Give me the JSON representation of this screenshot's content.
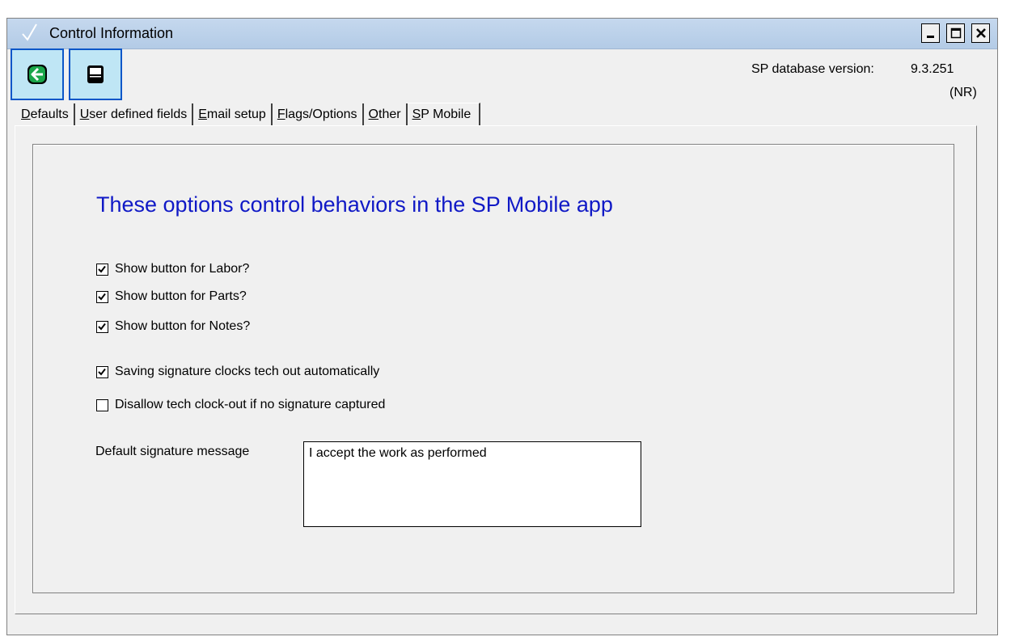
{
  "window": {
    "title": "Control Information",
    "controls": {
      "minimize_icon": "minimize-icon",
      "maximize_icon": "maximize-icon",
      "close_icon": "close-icon"
    }
  },
  "toolbar": {
    "back_icon": "back-arrow-icon",
    "save_icon": "floppy-disk-icon"
  },
  "version": {
    "label": "SP database version:",
    "value": "9.3.251",
    "suffix": "(NR)"
  },
  "tabs": [
    {
      "label": "Defaults",
      "hotkey": "D",
      "rest": "efaults",
      "active": false
    },
    {
      "label": "User defined fields",
      "hotkey": "U",
      "rest": "ser defined fields",
      "active": false
    },
    {
      "label": "Email setup",
      "hotkey": "E",
      "rest": "mail setup",
      "active": false
    },
    {
      "label": "Flags/Options",
      "hotkey": "F",
      "rest": "lags/Options",
      "active": false
    },
    {
      "label": "Other",
      "hotkey": "O",
      "rest": "ther",
      "active": false
    },
    {
      "label": "SP Mobile",
      "hotkey": "S",
      "rest": "P Mobile",
      "active": true
    }
  ],
  "mobile": {
    "heading": "These options control behaviors in the SP Mobile app",
    "options": [
      {
        "label": "Show button for Labor?",
        "checked": true
      },
      {
        "label": "Show button for Parts?",
        "checked": true
      },
      {
        "label": "Show button for Notes?",
        "checked": true
      },
      {
        "label": "Saving signature clocks tech out automatically",
        "checked": true
      },
      {
        "label": "Disallow tech clock-out if no signature captured",
        "checked": false
      }
    ],
    "signature_label": "Default signature message",
    "signature_value": "I accept the work as performed"
  },
  "colors": {
    "heading": "#1019c6",
    "titlebar": "#b3cbe6",
    "toolbar_button_bg": "#bfe6f5",
    "toolbar_button_border": "#0b56c8",
    "back_icon_green": "#1aa64a"
  }
}
